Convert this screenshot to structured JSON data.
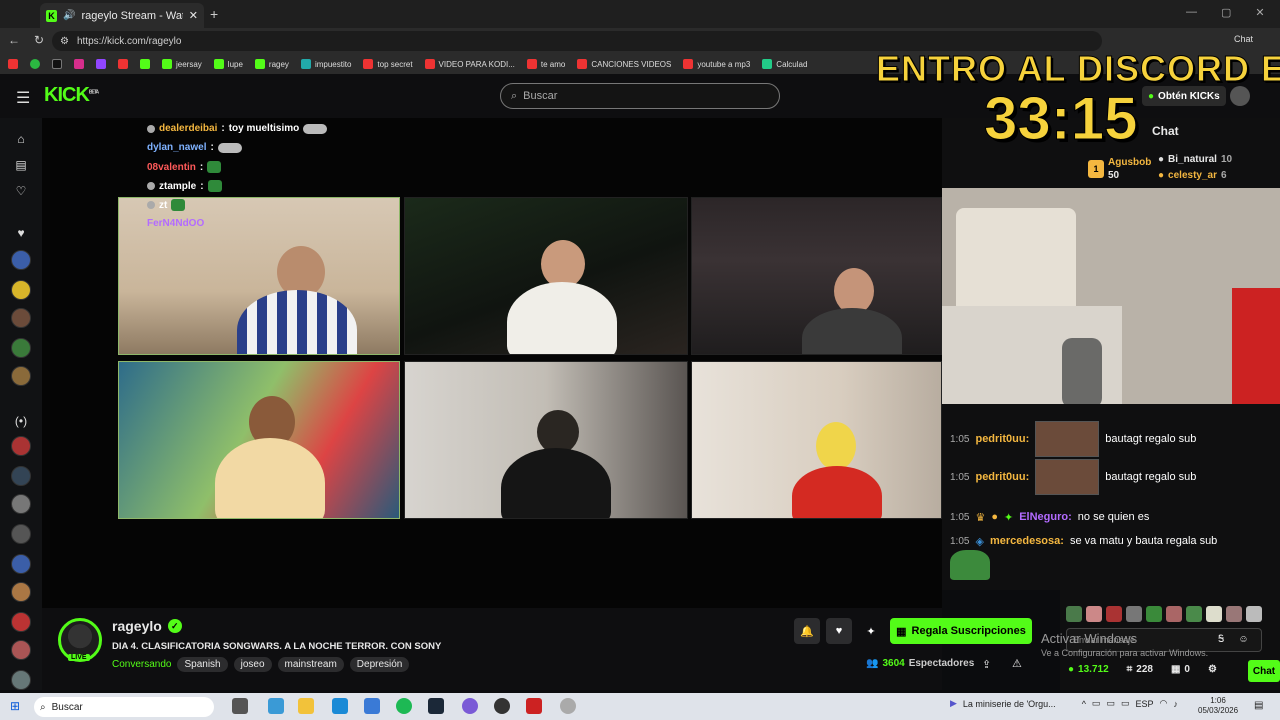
{
  "browser": {
    "tab_title": "rageylo Stream - Watch Live o",
    "url": "https://kick.com/rageylo",
    "profile_label": "Chat",
    "bookmarks": [
      "jeersay",
      "lupe",
      "ragey",
      "impuestito",
      "top secret",
      "VIDEO PARA KODI...",
      "te amo",
      "CANCIONES VIDEOS",
      "youtube a mp3",
      "Calculad"
    ]
  },
  "kick": {
    "logo": "KICK",
    "logo_badge": "BETA",
    "search_placeholder": "Buscar",
    "get_kicks": "Obtén KICKs"
  },
  "overlay": {
    "discord_line1": "ENTRO AL DISCORD EN",
    "discord_timer": "33:15",
    "chat_lines": [
      {
        "user": "dealerdeibai",
        "text": "toy mueltisimo",
        "color": "#f4b740"
      },
      {
        "user": "dylan_nawel",
        "text": "",
        "color": "#7fb2ff"
      },
      {
        "user": "08valentin",
        "text": "",
        "color": "#ff5a5a"
      },
      {
        "user": "ztample",
        "text": "",
        "color": "#ffffff"
      },
      {
        "user": "zt",
        "text": "",
        "color": "#ffffff"
      },
      {
        "user": "FerN4NdOO",
        "text": "",
        "color": "#b36bff"
      }
    ]
  },
  "chat": {
    "title": "Chat",
    "gifters": [
      {
        "rank": "1",
        "name": "Agusbob",
        "count": "50"
      },
      {
        "name": "Bi_natural",
        "count": "10"
      },
      {
        "name": "celesty_ar",
        "count": "6"
      }
    ],
    "messages": [
      {
        "time": "1:05",
        "user": "pedrit0uu:",
        "text": "bautagt regalo sub",
        "color": "#f4b740"
      },
      {
        "time": "1:05",
        "user": "pedrit0uu:",
        "text": "bautagt regalo sub",
        "color": "#f4b740"
      },
      {
        "time": "1:05",
        "user": "ElNeguro:",
        "text": "no se quien es",
        "color": "#b36bff"
      },
      {
        "time": "1:05",
        "user": "mercedesosa:",
        "text": "se va matu y bauta regala sub",
        "color": "#f4b740"
      }
    ],
    "send_placeholder": "Enviar mensaje",
    "points": "13.712",
    "subs": "228",
    "other": "0",
    "chat_button": "Chat"
  },
  "stream": {
    "name": "rageylo",
    "live": "LIVE",
    "title": "DIA 4. CLASIFICATORIA SONGWARS. A LA NOCHE TERROR. CON SONY",
    "category": "Conversando",
    "tags": [
      "Spanish",
      "joseo",
      "mainstream",
      "Depresión"
    ],
    "subscribe": "Regala Suscripciones",
    "viewers": "3604",
    "viewers_label": "Espectadores"
  },
  "windows": {
    "activate1": "Activar Windows",
    "activate2": "Ve a Configuración para activar Windows.",
    "search": "Buscar",
    "notification": "La miniserie de 'Orgu...",
    "lang": "ESP",
    "time": "1:06",
    "date": "05/03/2026"
  },
  "colors": {
    "kick_green": "#53fc18",
    "overlay_yellow": "#f6d23c"
  }
}
